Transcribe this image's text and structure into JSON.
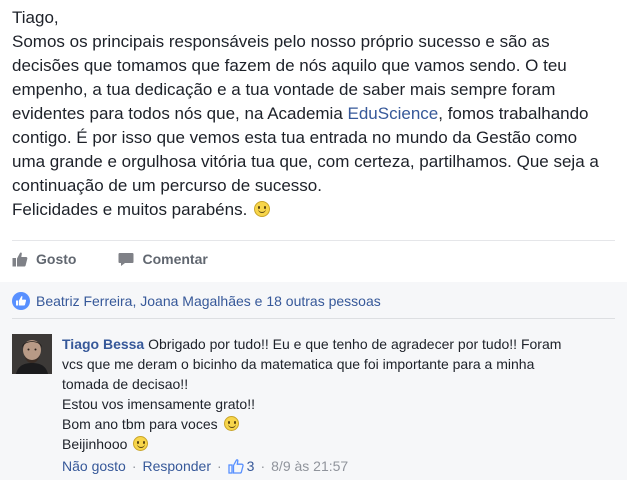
{
  "post": {
    "greeting": "Tiago,",
    "line1": "Somos os principais responsáveis pelo nosso próprio sucesso e são as",
    "line2": "decisões que tomamos que fazem de nós aquilo que vamos sendo. O teu",
    "line3": "empenho, a tua dedicação e a tua vontade de saber mais sempre foram",
    "line4_before": "evidentes para todos nós que, na Academia ",
    "line4_link": "EduScience",
    "line4_after": ", fomos trabalhando",
    "line5": "contigo. É por isso que vemos esta tua entrada no mundo da Gestão como",
    "line6": "uma grande e orgulhosa vitória tua que, com certeza, partilhamos. Que seja a",
    "line7": "continuação de um percurso de sucesso.",
    "line8": "Felicidades e muitos parabéns."
  },
  "actions": {
    "like_label": "Gosto",
    "comment_label": "Comentar"
  },
  "likes": {
    "text": "Beatriz Ferreira, Joana Magalhães e 18 outras pessoas"
  },
  "comment": {
    "author": "Tiago Bessa",
    "line1": " Obrigado por tudo!! Eu e que tenho de agradecer por tudo!! Foram",
    "line2": "vcs que me deram o bicinho da matematica que foi importante para a minha",
    "line3": "tomada de decisao!!",
    "line4": "Estou vos imensamente grato!!",
    "line5": "Bom ano tbm para voces",
    "line6": "Beijinhooo",
    "unlike_label": "Não gosto",
    "reply_label": "Responder",
    "like_count": "3",
    "timestamp": "8/9 às 21:57"
  },
  "colors": {
    "link": "#365899",
    "text": "#1d2129",
    "muted": "#616770",
    "comment_bg": "#f6f7f9"
  }
}
